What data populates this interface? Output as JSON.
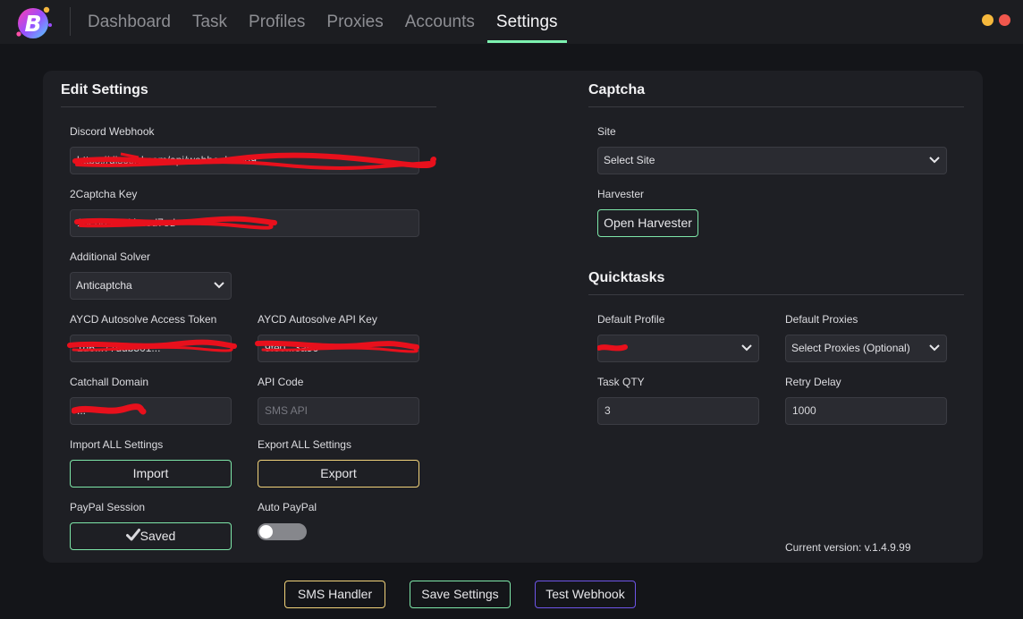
{
  "app": {
    "brand_color": "#7df2b0",
    "nav": [
      {
        "label": "Dashboard",
        "active": false
      },
      {
        "label": "Task",
        "active": false
      },
      {
        "label": "Profiles",
        "active": false
      },
      {
        "label": "Proxies",
        "active": false
      },
      {
        "label": "Accounts",
        "active": false
      },
      {
        "label": "Settings",
        "active": true
      }
    ],
    "window_buttons": [
      "minimize-icon",
      "close-icon"
    ]
  },
  "edit_settings": {
    "title": "Edit Settings",
    "discord_webhook": {
      "label": "Discord Webhook",
      "value": "https://discord.com/api/webhooks/869...",
      "redacted": true
    },
    "captcha_key": {
      "label": "2Captcha Key",
      "value": "10e06313d4...ed7ed",
      "redacted": true
    },
    "additional_solver": {
      "label": "Additional Solver",
      "value": "Anticaptcha"
    },
    "aycd_token": {
      "label": "AYCD Autosolve Access Token",
      "value": "1d6...77ddb501...",
      "redacted": true
    },
    "aycd_api_key": {
      "label": "AYCD Autosolve API Key",
      "value": "9fe0...3a56",
      "redacted": true
    },
    "catchall_domain": {
      "label": "Catchall Domain",
      "value": "...",
      "redacted": true
    },
    "api_code": {
      "label": "API Code",
      "placeholder": "SMS API"
    },
    "import_label": "Import ALL Settings",
    "import_button": "Import",
    "export_label": "Export ALL Settings",
    "export_button": "Export",
    "paypal_session_label": "PayPal Session",
    "paypal_session_button": "Saved",
    "auto_paypal_label": "Auto PayPal",
    "auto_paypal_enabled": false
  },
  "captcha": {
    "title": "Captcha",
    "site_label": "Site",
    "site_value": "Select Site",
    "harvester_label": "Harvester",
    "harvester_button": "Open Harvester"
  },
  "quicktasks": {
    "title": "Quicktasks",
    "default_profile_label": "Default Profile",
    "default_profile_value": "...",
    "default_proxies_label": "Default Proxies",
    "default_proxies_value": "Select Proxies (Optional)",
    "task_qty_label": "Task QTY",
    "task_qty_value": "3",
    "retry_delay_label": "Retry Delay",
    "retry_delay_value": "1000"
  },
  "version": "Current version: v.1.4.9.99",
  "footer": {
    "sms_handler": "SMS Handler",
    "save_settings": "Save Settings",
    "test_webhook": "Test Webhook"
  },
  "colors": {
    "green": "#7ee7a9",
    "yellow": "#f2d37a",
    "purple": "#6e55e8",
    "redaction": "#e8101c"
  }
}
